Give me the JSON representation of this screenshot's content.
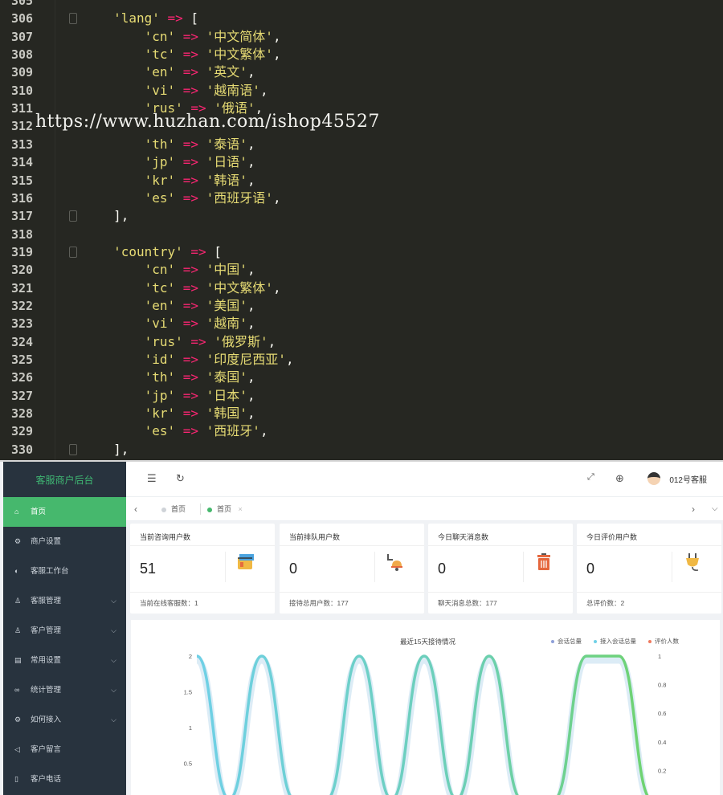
{
  "editor": {
    "watermark": "https://www.huzhan.com/ishop45527",
    "lines": [
      {
        "n": "305",
        "segs": []
      },
      {
        "n": "306",
        "fold": true,
        "segs": [
          {
            "t": "        "
          },
          {
            "t": "'lang'",
            "c": "s"
          },
          {
            "t": " "
          },
          {
            "t": "=>",
            "c": "op"
          },
          {
            "t": " ["
          }
        ]
      },
      {
        "n": "307",
        "segs": [
          {
            "t": "            "
          },
          {
            "t": "'cn'",
            "c": "s"
          },
          {
            "t": " "
          },
          {
            "t": "=>",
            "c": "op"
          },
          {
            "t": " "
          },
          {
            "t": "'中文简体'",
            "c": "s"
          },
          {
            "t": ","
          }
        ]
      },
      {
        "n": "308",
        "segs": [
          {
            "t": "            "
          },
          {
            "t": "'tc'",
            "c": "s"
          },
          {
            "t": " "
          },
          {
            "t": "=>",
            "c": "op"
          },
          {
            "t": " "
          },
          {
            "t": "'中文繁体'",
            "c": "s"
          },
          {
            "t": ","
          }
        ]
      },
      {
        "n": "309",
        "segs": [
          {
            "t": "            "
          },
          {
            "t": "'en'",
            "c": "s"
          },
          {
            "t": " "
          },
          {
            "t": "=>",
            "c": "op"
          },
          {
            "t": " "
          },
          {
            "t": "'英文'",
            "c": "s"
          },
          {
            "t": ","
          }
        ]
      },
      {
        "n": "310",
        "segs": [
          {
            "t": "            "
          },
          {
            "t": "'vi'",
            "c": "s"
          },
          {
            "t": " "
          },
          {
            "t": "=>",
            "c": "op"
          },
          {
            "t": " "
          },
          {
            "t": "'越南语'",
            "c": "s"
          },
          {
            "t": ","
          }
        ]
      },
      {
        "n": "311",
        "segs": [
          {
            "t": "            "
          },
          {
            "t": "'rus'",
            "c": "s"
          },
          {
            "t": " "
          },
          {
            "t": "=>",
            "c": "op"
          },
          {
            "t": " "
          },
          {
            "t": "'俄语'",
            "c": "s"
          },
          {
            "t": ","
          }
        ]
      },
      {
        "n": "312",
        "segs": []
      },
      {
        "n": "313",
        "segs": [
          {
            "t": "            "
          },
          {
            "t": "'th'",
            "c": "s"
          },
          {
            "t": " "
          },
          {
            "t": "=>",
            "c": "op"
          },
          {
            "t": " "
          },
          {
            "t": "'泰语'",
            "c": "s"
          },
          {
            "t": ","
          }
        ]
      },
      {
        "n": "314",
        "segs": [
          {
            "t": "            "
          },
          {
            "t": "'jp'",
            "c": "s"
          },
          {
            "t": " "
          },
          {
            "t": "=>",
            "c": "op"
          },
          {
            "t": " "
          },
          {
            "t": "'日语'",
            "c": "s"
          },
          {
            "t": ","
          }
        ]
      },
      {
        "n": "315",
        "segs": [
          {
            "t": "            "
          },
          {
            "t": "'kr'",
            "c": "s"
          },
          {
            "t": " "
          },
          {
            "t": "=>",
            "c": "op"
          },
          {
            "t": " "
          },
          {
            "t": "'韩语'",
            "c": "s"
          },
          {
            "t": ","
          }
        ]
      },
      {
        "n": "316",
        "segs": [
          {
            "t": "            "
          },
          {
            "t": "'es'",
            "c": "s"
          },
          {
            "t": " "
          },
          {
            "t": "=>",
            "c": "op"
          },
          {
            "t": " "
          },
          {
            "t": "'西班牙语'",
            "c": "s"
          },
          {
            "t": ","
          }
        ]
      },
      {
        "n": "317",
        "fold": true,
        "segs": [
          {
            "t": "        ],"
          }
        ]
      },
      {
        "n": "318",
        "segs": []
      },
      {
        "n": "319",
        "fold": true,
        "segs": [
          {
            "t": "        "
          },
          {
            "t": "'country'",
            "c": "s"
          },
          {
            "t": " "
          },
          {
            "t": "=>",
            "c": "op"
          },
          {
            "t": " ["
          }
        ]
      },
      {
        "n": "320",
        "segs": [
          {
            "t": "            "
          },
          {
            "t": "'cn'",
            "c": "s"
          },
          {
            "t": " "
          },
          {
            "t": "=>",
            "c": "op"
          },
          {
            "t": " "
          },
          {
            "t": "'中国'",
            "c": "s"
          },
          {
            "t": ","
          }
        ]
      },
      {
        "n": "321",
        "segs": [
          {
            "t": "            "
          },
          {
            "t": "'tc'",
            "c": "s"
          },
          {
            "t": " "
          },
          {
            "t": "=>",
            "c": "op"
          },
          {
            "t": " "
          },
          {
            "t": "'中文繁体'",
            "c": "s"
          },
          {
            "t": ","
          }
        ]
      },
      {
        "n": "322",
        "segs": [
          {
            "t": "            "
          },
          {
            "t": "'en'",
            "c": "s"
          },
          {
            "t": " "
          },
          {
            "t": "=>",
            "c": "op"
          },
          {
            "t": " "
          },
          {
            "t": "'美国'",
            "c": "s"
          },
          {
            "t": ","
          }
        ]
      },
      {
        "n": "323",
        "segs": [
          {
            "t": "            "
          },
          {
            "t": "'vi'",
            "c": "s"
          },
          {
            "t": " "
          },
          {
            "t": "=>",
            "c": "op"
          },
          {
            "t": " "
          },
          {
            "t": "'越南'",
            "c": "s"
          },
          {
            "t": ","
          }
        ]
      },
      {
        "n": "324",
        "segs": [
          {
            "t": "            "
          },
          {
            "t": "'rus'",
            "c": "s"
          },
          {
            "t": " "
          },
          {
            "t": "=>",
            "c": "op"
          },
          {
            "t": " "
          },
          {
            "t": "'俄罗斯'",
            "c": "s"
          },
          {
            "t": ","
          }
        ]
      },
      {
        "n": "325",
        "segs": [
          {
            "t": "            "
          },
          {
            "t": "'id'",
            "c": "s"
          },
          {
            "t": " "
          },
          {
            "t": "=>",
            "c": "op"
          },
          {
            "t": " "
          },
          {
            "t": "'印度尼西亚'",
            "c": "s"
          },
          {
            "t": ","
          }
        ]
      },
      {
        "n": "326",
        "segs": [
          {
            "t": "            "
          },
          {
            "t": "'th'",
            "c": "s"
          },
          {
            "t": " "
          },
          {
            "t": "=>",
            "c": "op"
          },
          {
            "t": " "
          },
          {
            "t": "'泰国'",
            "c": "s"
          },
          {
            "t": ","
          }
        ]
      },
      {
        "n": "327",
        "segs": [
          {
            "t": "            "
          },
          {
            "t": "'jp'",
            "c": "s"
          },
          {
            "t": " "
          },
          {
            "t": "=>",
            "c": "op"
          },
          {
            "t": " "
          },
          {
            "t": "'日本'",
            "c": "s"
          },
          {
            "t": ","
          }
        ]
      },
      {
        "n": "328",
        "segs": [
          {
            "t": "            "
          },
          {
            "t": "'kr'",
            "c": "s"
          },
          {
            "t": " "
          },
          {
            "t": "=>",
            "c": "op"
          },
          {
            "t": " "
          },
          {
            "t": "'韩国'",
            "c": "s"
          },
          {
            "t": ","
          }
        ]
      },
      {
        "n": "329",
        "segs": [
          {
            "t": "            "
          },
          {
            "t": "'es'",
            "c": "s"
          },
          {
            "t": " "
          },
          {
            "t": "=>",
            "c": "op"
          },
          {
            "t": " "
          },
          {
            "t": "'西班牙'",
            "c": "s"
          },
          {
            "t": ","
          }
        ]
      },
      {
        "n": "330",
        "fold": true,
        "segs": [
          {
            "t": "        ],"
          }
        ]
      }
    ]
  },
  "admin": {
    "brand": "客服商户后台",
    "sidebar": [
      {
        "label": "首页",
        "icon": "home-icon",
        "glyph": "⌂",
        "active": true,
        "expandable": false
      },
      {
        "label": "商户设置",
        "icon": "gear-icon",
        "glyph": "⚙",
        "active": false,
        "expandable": false
      },
      {
        "label": "客服工作台",
        "icon": "workbench-icon",
        "glyph": "◐",
        "active": false,
        "expandable": false
      },
      {
        "label": "客服管理",
        "icon": "user-icon",
        "glyph": "♙",
        "active": false,
        "expandable": true
      },
      {
        "label": "客户管理",
        "icon": "customer-icon",
        "glyph": "♙",
        "active": false,
        "expandable": true
      },
      {
        "label": "常用设置",
        "icon": "settings-doc-icon",
        "glyph": "▤",
        "active": false,
        "expandable": true
      },
      {
        "label": "统计管理",
        "icon": "stats-icon",
        "glyph": "∞",
        "active": false,
        "expandable": true
      },
      {
        "label": "如何接入",
        "icon": "plug-settings-icon",
        "glyph": "⚙",
        "active": false,
        "expandable": true
      },
      {
        "label": "客户留言",
        "icon": "send-icon",
        "glyph": "◁",
        "active": false,
        "expandable": false
      },
      {
        "label": "客户电话",
        "icon": "phone-icon",
        "glyph": "▯",
        "active": false,
        "expandable": false
      }
    ],
    "user": "012号客服",
    "tabs": [
      "首页",
      "首页"
    ],
    "cards": [
      {
        "title": "当前咨询用户数",
        "value": "51",
        "footer": "当前在线客服数：1",
        "icon": "paint-bucket-icon"
      },
      {
        "title": "当前排队用户数",
        "value": "0",
        "footer": "接待总用户数：177",
        "icon": "bell-icon"
      },
      {
        "title": "今日聊天消息数",
        "value": "0",
        "footer": "聊天消息总数：177",
        "icon": "trash-can-icon"
      },
      {
        "title": "今日评价用户数",
        "value": "0",
        "footer": "总评价数：2",
        "icon": "plug-icon"
      }
    ],
    "colors": {
      "brand": "#3fb773",
      "active": "#46b86d",
      "sidebar": "#28333e"
    }
  },
  "chart_data": {
    "type": "line",
    "title": "最近15天接待情况",
    "series": [
      {
        "name": "会话总量",
        "color": "#8fa0d8",
        "values": []
      },
      {
        "name": "接入会话总量",
        "color": "#6fd0e6",
        "values": [
          2,
          0,
          2,
          0,
          0,
          2,
          0,
          2,
          0,
          2,
          0,
          0,
          2,
          2,
          0
        ]
      },
      {
        "name": "评价人数",
        "color": "#ef7a5e",
        "values": []
      }
    ],
    "y_left": {
      "ticks": [
        "2",
        "1.5",
        "1",
        "0.5"
      ],
      "range": [
        0,
        2
      ]
    },
    "y_right": {
      "ticks": [
        "1",
        "0.8",
        "0.6",
        "0.4",
        "0.2"
      ],
      "range": [
        0,
        1
      ]
    },
    "legend": "top-right",
    "grid": false
  }
}
